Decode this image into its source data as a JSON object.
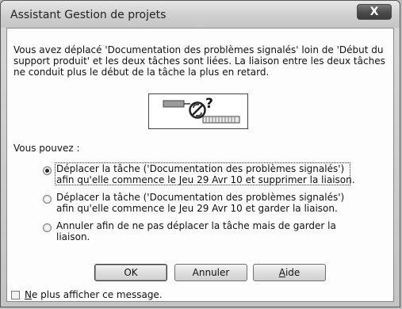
{
  "window": {
    "title": "Assistant Gestion de projets",
    "close_symbol": "X"
  },
  "message": "Vous avez déplacé 'Documentation des problèmes signalés' loin de 'Début du support produit' et les deux tâches sont liées. La liaison entre les deux tâches ne conduit plus le début de la tâche la plus en retard.",
  "illustration": {
    "icon": "no-link-question-icon",
    "symbol": "?"
  },
  "prompt": "Vous pouvez :",
  "options": [
    {
      "line1": "Déplacer la tâche ('Documentation des problèmes signalés')",
      "line2": "afin qu'elle commence le Jeu 29 Avr 10 et supprimer la liaison.",
      "selected": true
    },
    {
      "line1": "Déplacer la tâche ('Documentation des problèmes signalés')",
      "line2": "afin qu'elle commence le Jeu 29 Avr 10 et garder la liaison.",
      "selected": false
    },
    {
      "line1": "Annuler afin de ne pas déplacer la tâche mais de garder la",
      "line2": "liaison.",
      "selected": false
    }
  ],
  "buttons": {
    "ok": "OK",
    "cancel": "Annuler",
    "help_mnemonic": "A",
    "help_rest": "ide"
  },
  "checkbox": {
    "mnemonic": "N",
    "rest": "e plus afficher ce message.",
    "checked": false
  }
}
